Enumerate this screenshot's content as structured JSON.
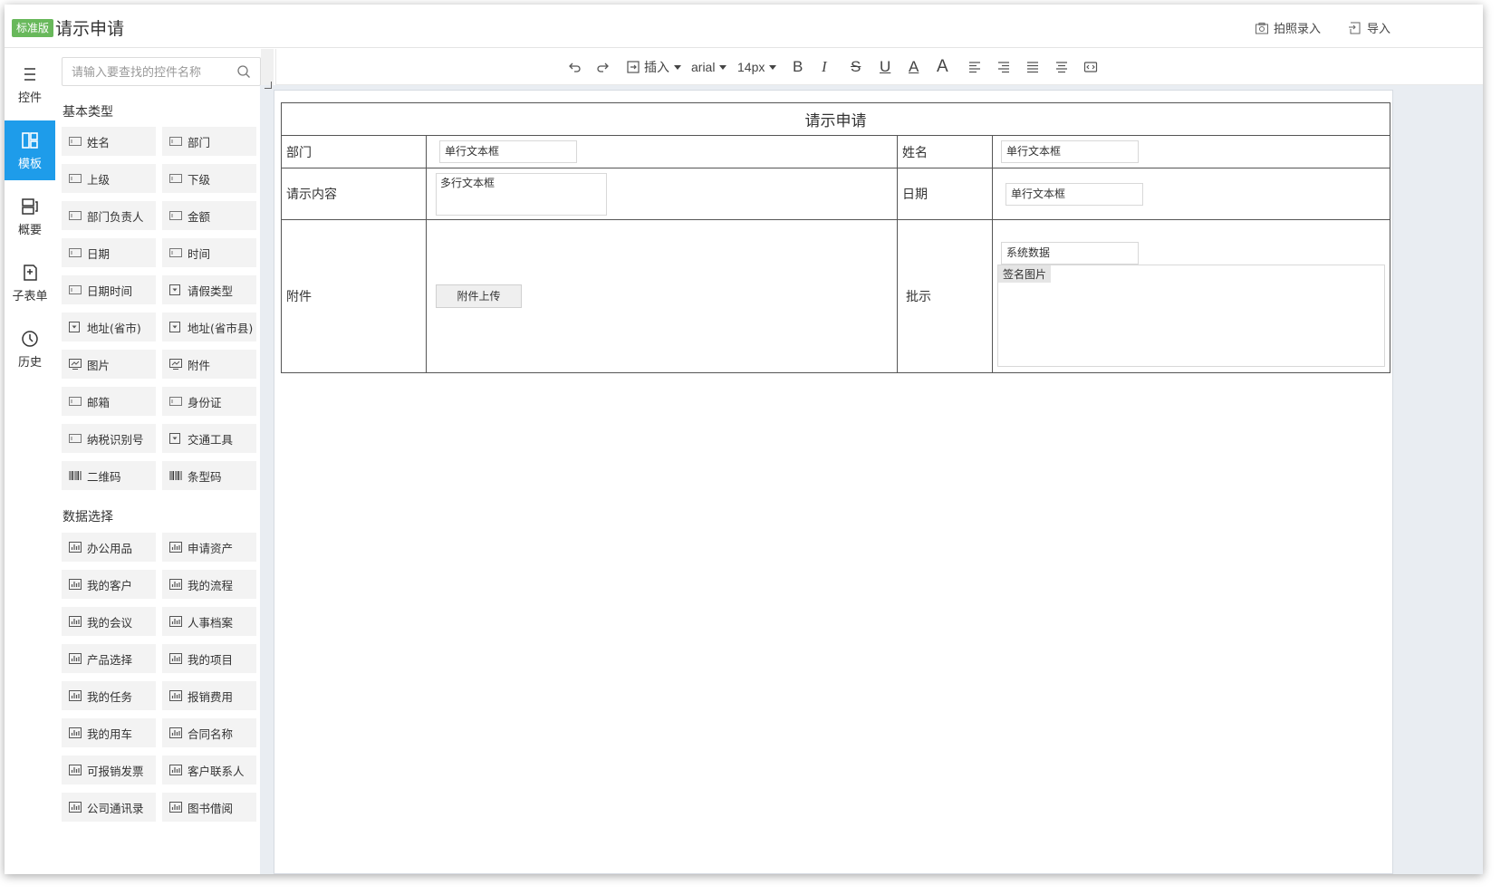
{
  "header": {
    "badge": "标准版",
    "title": "请示申请",
    "photo_entry": "拍照录入",
    "import": "导入"
  },
  "rail": [
    {
      "label": "控件",
      "icon": "menu-icon",
      "active": false
    },
    {
      "label": "模板",
      "icon": "template-icon",
      "active": true
    },
    {
      "label": "概要",
      "icon": "summary-icon",
      "active": false
    },
    {
      "label": "子表单",
      "icon": "subform-icon",
      "active": false
    },
    {
      "label": "历史",
      "icon": "history-icon",
      "active": false
    }
  ],
  "panel": {
    "search_placeholder": "请输入要查找的控件名称",
    "basic_title": "基本类型",
    "basic": [
      {
        "label": "姓名",
        "icon": "textbox-icon"
      },
      {
        "label": "部门",
        "icon": "textbox-icon"
      },
      {
        "label": "上级",
        "icon": "textbox-icon"
      },
      {
        "label": "下级",
        "icon": "textbox-icon"
      },
      {
        "label": "部门负责人",
        "icon": "textbox-icon"
      },
      {
        "label": "金额",
        "icon": "textbox-icon"
      },
      {
        "label": "日期",
        "icon": "textbox-icon"
      },
      {
        "label": "时间",
        "icon": "textbox-icon"
      },
      {
        "label": "日期时间",
        "icon": "textbox-icon"
      },
      {
        "label": "请假类型",
        "icon": "dropdown-icon"
      },
      {
        "label": "地址(省市)",
        "icon": "dropdown-icon"
      },
      {
        "label": "地址(省市县)",
        "icon": "dropdown-icon"
      },
      {
        "label": "图片",
        "icon": "image-icon"
      },
      {
        "label": "附件",
        "icon": "image-icon"
      },
      {
        "label": "邮箱",
        "icon": "textbox-icon"
      },
      {
        "label": "身份证",
        "icon": "textbox-icon"
      },
      {
        "label": "纳税识别号",
        "icon": "textbox-icon"
      },
      {
        "label": "交通工具",
        "icon": "dropdown-icon"
      },
      {
        "label": "二维码",
        "icon": "barcode-icon"
      },
      {
        "label": "条型码",
        "icon": "barcode-icon"
      }
    ],
    "data_title": "数据选择",
    "data": [
      {
        "label": "办公用品",
        "icon": "data-icon"
      },
      {
        "label": "申请资产",
        "icon": "data-icon"
      },
      {
        "label": "我的客户",
        "icon": "data-icon"
      },
      {
        "label": "我的流程",
        "icon": "data-icon"
      },
      {
        "label": "我的会议",
        "icon": "data-icon"
      },
      {
        "label": "人事档案",
        "icon": "data-icon"
      },
      {
        "label": "产品选择",
        "icon": "data-icon"
      },
      {
        "label": "我的项目",
        "icon": "data-icon"
      },
      {
        "label": "我的任务",
        "icon": "data-icon"
      },
      {
        "label": "报销费用",
        "icon": "data-icon"
      },
      {
        "label": "我的用车",
        "icon": "data-icon"
      },
      {
        "label": "合同名称",
        "icon": "data-icon"
      },
      {
        "label": "可报销发票",
        "icon": "data-icon"
      },
      {
        "label": "客户联系人",
        "icon": "data-icon"
      },
      {
        "label": "公司通讯录",
        "icon": "data-icon"
      },
      {
        "label": "图书借阅",
        "icon": "data-icon"
      }
    ]
  },
  "toolbar": {
    "insert": "插入",
    "font": "arial",
    "size": "14px"
  },
  "form": {
    "title": "请示申请",
    "dept_label": "部门",
    "dept_field": "单行文本框",
    "name_label": "姓名",
    "name_field": "单行文本框",
    "content_label": "请示内容",
    "content_field": "多行文本框",
    "date_label": "日期",
    "date_field": "单行文本框",
    "attach_label": "附件",
    "upload_button": "附件上传",
    "approve_label": "批示",
    "system_field": "系统数据",
    "signature_tag": "签名图片"
  }
}
